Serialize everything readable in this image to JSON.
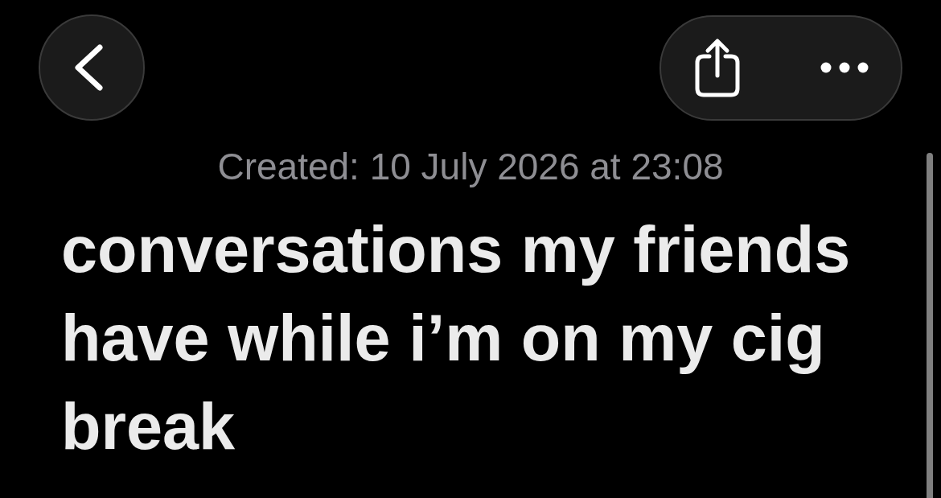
{
  "note": {
    "created": "Created: 10 July 2026 at 23:08",
    "title": "conversations my friends have while i’m on my cig break"
  }
}
